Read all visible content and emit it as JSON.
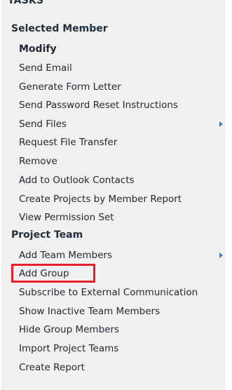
{
  "panel": {
    "title": "TASKS"
  },
  "sections": [
    {
      "header": "Selected Member",
      "items": [
        {
          "label": "Modify",
          "bold": true
        },
        {
          "label": "Send Email"
        },
        {
          "label": "Generate Form Letter"
        },
        {
          "label": "Send Password Reset Instructions"
        },
        {
          "label": "Send Files",
          "submenu": true
        },
        {
          "label": "Request File Transfer"
        },
        {
          "label": "Remove"
        },
        {
          "label": "Add to Outlook Contacts"
        },
        {
          "label": "Create Projects by Member Report"
        },
        {
          "label": "View Permission Set"
        }
      ]
    },
    {
      "header": "Project Team",
      "items": [
        {
          "label": "Add Team Members",
          "submenu": true
        },
        {
          "label": "Add Group",
          "highlighted": true
        },
        {
          "label": "Subscribe to External Communication"
        },
        {
          "label": "Show Inactive Team Members"
        },
        {
          "label": "Hide Group Members"
        },
        {
          "label": "Import Project Teams"
        },
        {
          "label": "Create Report"
        }
      ]
    }
  ],
  "highlight_color": "#e8202a",
  "accent_color": "#3f79bf"
}
